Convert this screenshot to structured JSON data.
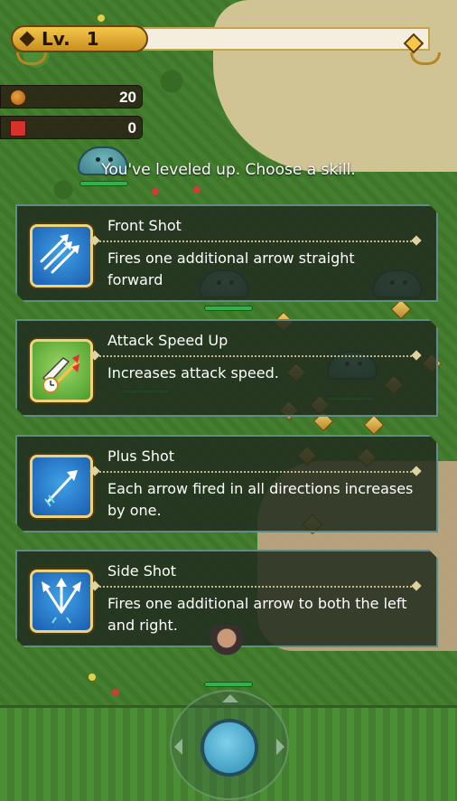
{
  "hud": {
    "level_label": "Lv.",
    "level_value": "1",
    "coins": "20",
    "chests": "0",
    "icons": [
      "coin-icon",
      "chest-icon"
    ]
  },
  "prompt": "You've leveled up. Choose a skill.",
  "skills": [
    {
      "name": "Front Shot",
      "description": "Fires one additional arrow straight forward",
      "icon": "front-shot-arrows-icon"
    },
    {
      "name": "Attack Speed Up",
      "description": "Increases attack speed.",
      "icon": "attack-speed-icon"
    },
    {
      "name": "Plus Shot",
      "description": "Each arrow fired in all directions increases by one.",
      "icon": "plus-shot-arrow-icon"
    },
    {
      "name": "Side Shot",
      "description": "Fires one additional arrow to both the left and right.",
      "icon": "side-shot-arrows-icon"
    }
  ],
  "colors": {
    "card_bg": "#222c1e",
    "card_border": "#5f8d86",
    "gold": "#f5c84a",
    "icon_blue": "#1a5cb0",
    "icon_green": "#4a9b2d"
  }
}
